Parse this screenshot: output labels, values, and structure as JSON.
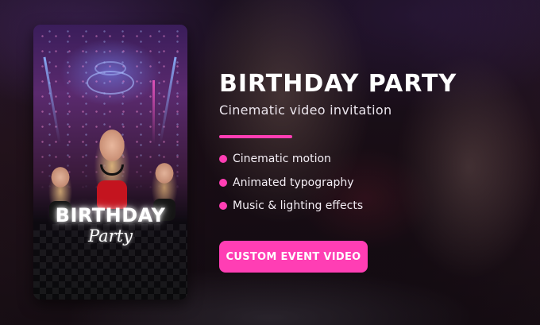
{
  "colors": {
    "accent": "#ff3eb4",
    "text": "#ffffff"
  },
  "poster": {
    "title_text": "BIRTHDAY",
    "script_text": "Party"
  },
  "hero": {
    "title": "BIRTHDAY PARTY",
    "subtitle": "Cinematic video invitation"
  },
  "features": [
    {
      "label": "Cinematic motion",
      "icon": "bullet-dot"
    },
    {
      "label": "Animated typography",
      "icon": "bullet-dot"
    },
    {
      "label": "Music & lighting effects",
      "icon": "bullet-dot"
    }
  ],
  "cta": {
    "label": "CUSTOM EVENT VIDEO"
  }
}
